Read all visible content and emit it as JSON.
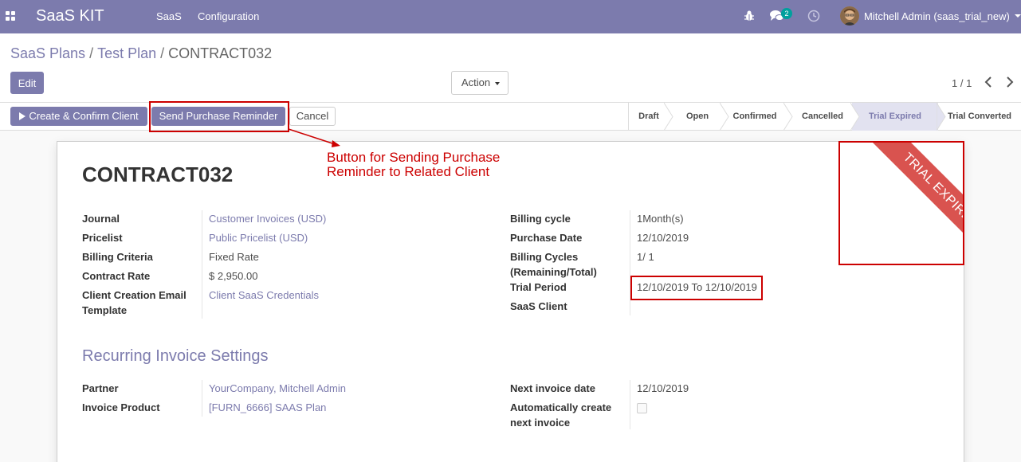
{
  "navbar": {
    "brand": "SaaS KIT",
    "menu": [
      "SaaS",
      "Configuration"
    ],
    "chat_badge": "2",
    "user": "Mitchell Admin (saas_trial_new)"
  },
  "breadcrumb": [
    "SaaS Plans",
    "Test Plan",
    "CONTRACT032"
  ],
  "buttons": {
    "edit": "Edit",
    "action": "Action",
    "create_confirm": "Create & Confirm Client",
    "send_reminder": "Send Purchase Reminder",
    "cancel": "Cancel"
  },
  "pager": "1 / 1",
  "stages": [
    "Draft",
    "Open",
    "Confirmed",
    "Cancelled",
    "Trial Expired",
    "Trial Converted"
  ],
  "active_stage": "Trial Expired",
  "record": {
    "title": "CONTRACT032",
    "ribbon": "TRIAL EXPIRED",
    "left_fields": [
      {
        "label": "Journal",
        "value": "Customer Invoices (USD)"
      },
      {
        "label": "Pricelist",
        "value": "Public Pricelist (USD)"
      },
      {
        "label": "Billing Criteria",
        "value": "Fixed Rate"
      },
      {
        "label": "Contract Rate",
        "value": "$ 2,950.00"
      },
      {
        "label": "Client Creation Email Template",
        "value": "Client SaaS Credentials"
      }
    ],
    "right_fields": [
      {
        "label": "Billing cycle",
        "value": "1Month(s)"
      },
      {
        "label": "Purchase Date",
        "value": "12/10/2019"
      },
      {
        "label": "Billing Cycles (Remaining/Total)",
        "value": "1/ 1"
      },
      {
        "label": "Trial Period",
        "value": "12/10/2019 To 12/10/2019"
      },
      {
        "label": "SaaS Client",
        "value": ""
      }
    ],
    "section_title": "Recurring Invoice Settings",
    "invoice_left": [
      {
        "label": "Partner",
        "value": "YourCompany, Mitchell Admin"
      },
      {
        "label": "Invoice Product",
        "value": "[FURN_6666] SAAS Plan"
      }
    ],
    "invoice_right": [
      {
        "label": "Next invoice date",
        "value": "12/10/2019"
      },
      {
        "label": "Automatically create next invoice",
        "value": false
      }
    ]
  },
  "annotation": {
    "text": "Button for Sending Purchase Reminder to Related Client",
    "color": "#cc0000"
  },
  "colors": {
    "brand": "#7c7bad",
    "ribbon": "#d9534f",
    "badge": "#00a09d"
  }
}
